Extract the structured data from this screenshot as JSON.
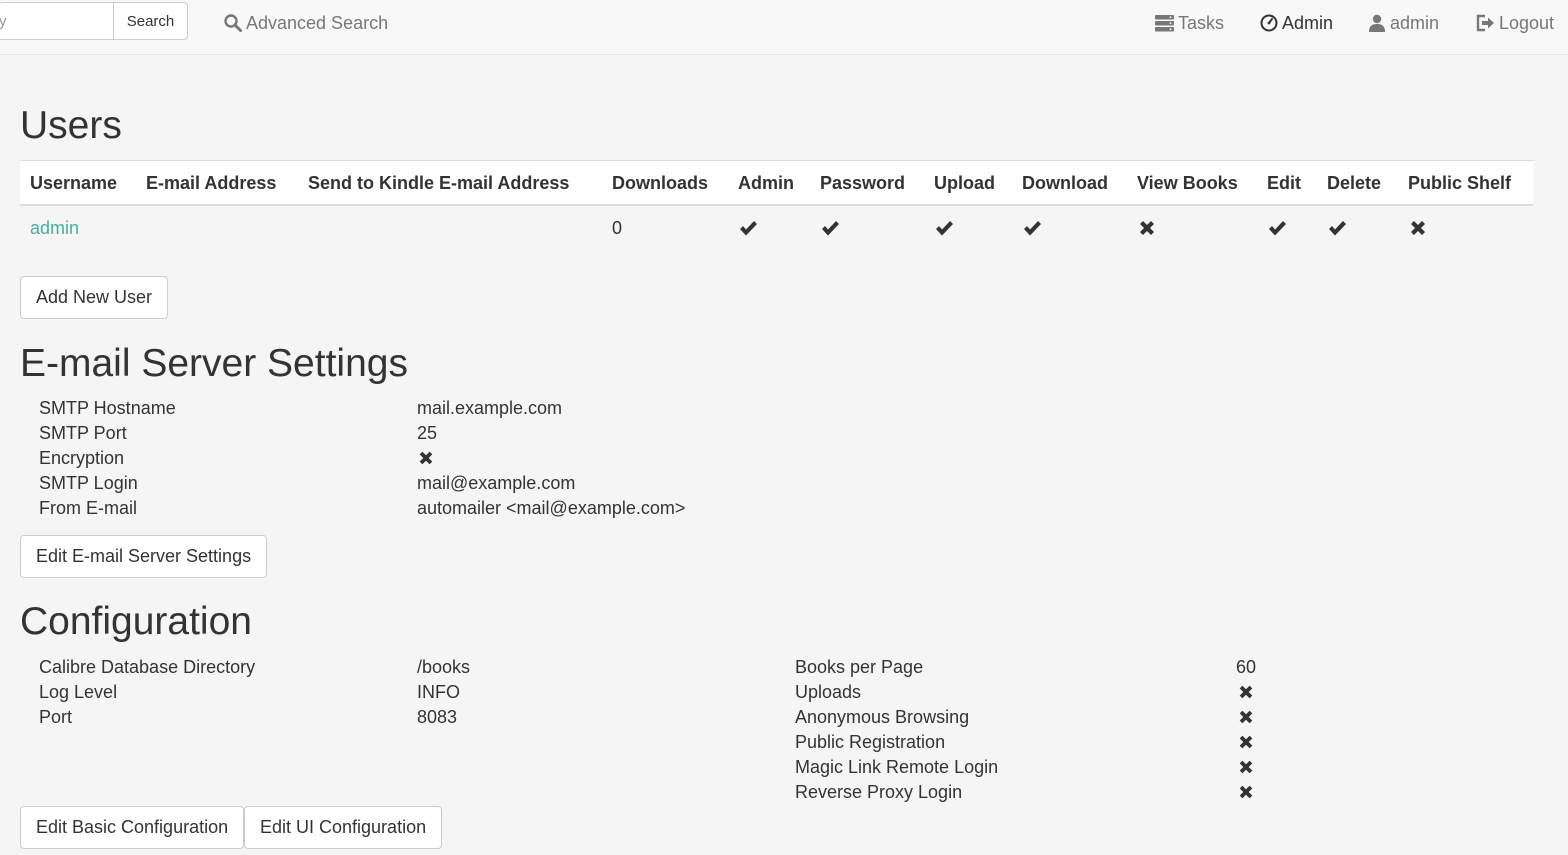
{
  "navbar": {
    "search_value": "y",
    "search_button": "Search",
    "advanced_search": "Advanced Search",
    "tasks": "Tasks",
    "admin": "Admin",
    "user": "admin",
    "logout": "Logout"
  },
  "users": {
    "title": "Users",
    "columns": [
      "Username",
      "E-mail Address",
      "Send to Kindle E-mail Address",
      "Downloads",
      "Admin",
      "Password",
      "Upload",
      "Download",
      "View Books",
      "Edit",
      "Delete",
      "Public Shelf"
    ],
    "rows": [
      {
        "username": "admin",
        "email": "",
        "kindle_email": "",
        "downloads": "0",
        "admin": true,
        "password": true,
        "upload": true,
        "download": true,
        "view_books": false,
        "edit": true,
        "delete": true,
        "public_shelf": false
      }
    ],
    "add_button": "Add New User"
  },
  "email": {
    "title": "E-mail Server Settings",
    "rows": [
      {
        "label": "SMTP Hostname",
        "value": "mail.example.com"
      },
      {
        "label": "SMTP Port",
        "value": "25"
      },
      {
        "label": "Encryption",
        "value": false
      },
      {
        "label": "SMTP Login",
        "value": "mail@example.com"
      },
      {
        "label": "From E-mail",
        "value": "automailer <mail@example.com>"
      }
    ],
    "edit_button": "Edit E-mail Server Settings"
  },
  "config": {
    "title": "Configuration",
    "left": [
      {
        "label": "Calibre Database Directory",
        "value": "/books"
      },
      {
        "label": "Log Level",
        "value": "INFO"
      },
      {
        "label": "Port",
        "value": "8083"
      }
    ],
    "right": [
      {
        "label": "Books per Page",
        "value": "60"
      },
      {
        "label": "Uploads",
        "value": false
      },
      {
        "label": "Anonymous Browsing",
        "value": false
      },
      {
        "label": "Public Registration",
        "value": false
      },
      {
        "label": "Magic Link Remote Login",
        "value": false
      },
      {
        "label": "Reverse Proxy Login",
        "value": false
      }
    ],
    "edit_basic_button": "Edit Basic Configuration",
    "edit_ui_button": "Edit UI Configuration"
  }
}
